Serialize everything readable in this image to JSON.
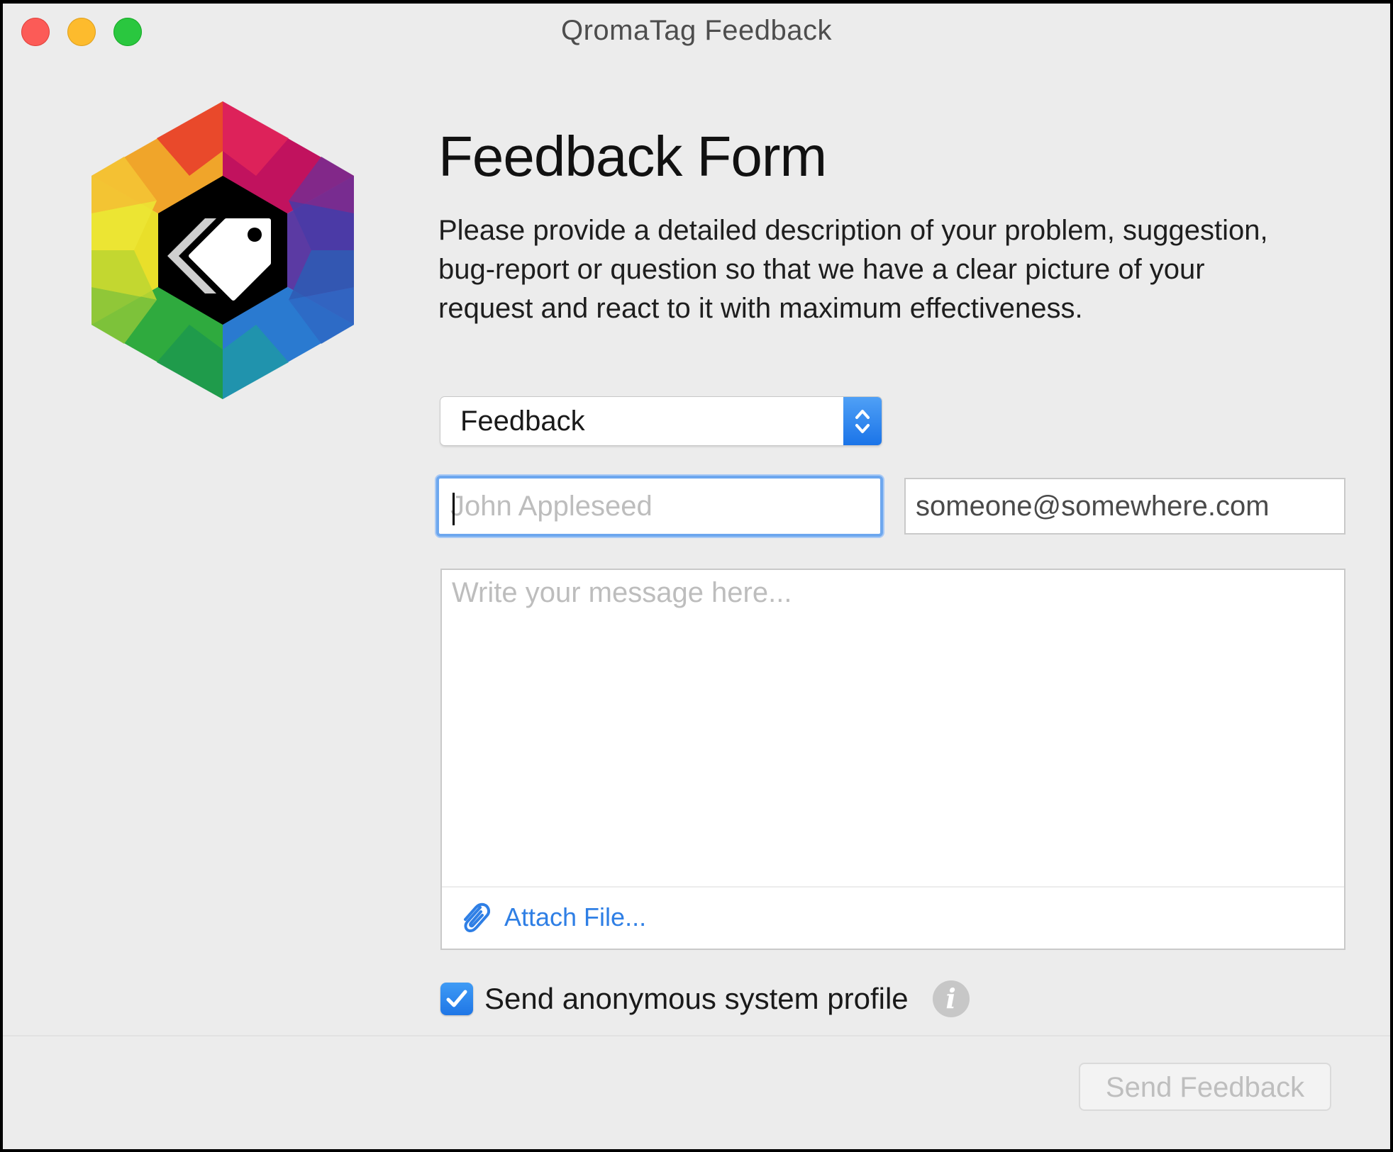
{
  "window": {
    "title": "QromaTag Feedback"
  },
  "icons": {
    "close": "close-button",
    "minimize": "minimize-button",
    "zoom": "zoom-button",
    "logo": "qromatag-hexagon-tag-logo",
    "select_stepper": "chevron-up-down-icon",
    "attach": "paperclip-icon",
    "checkbox": "checkmark-icon",
    "info": "info-icon"
  },
  "colors": {
    "accent": "#2f7fe5",
    "focus_ring": "#6da7ee",
    "close": "#fc5b57",
    "minimize": "#fdbb2d",
    "zoom": "#2ac73f"
  },
  "form": {
    "title": "Feedback Form",
    "description": "Please provide a detailed description of your problem, suggestion, bug-report or question so that we have a clear picture of your request and react to it with maximum effectiveness.",
    "type_select": {
      "selected": "Feedback"
    },
    "name_field": {
      "value": "",
      "placeholder": "John Appleseed",
      "focused": true
    },
    "email_field": {
      "value": "",
      "placeholder": "someone@somewhere.com"
    },
    "message": {
      "value": "",
      "placeholder": "Write your message here..."
    },
    "attach_label": "Attach File...",
    "system_profile": {
      "label": "Send anonymous system profile",
      "checked": true,
      "info_glyph": "i"
    },
    "send_button": {
      "label": "Send Feedback",
      "enabled": false
    }
  }
}
